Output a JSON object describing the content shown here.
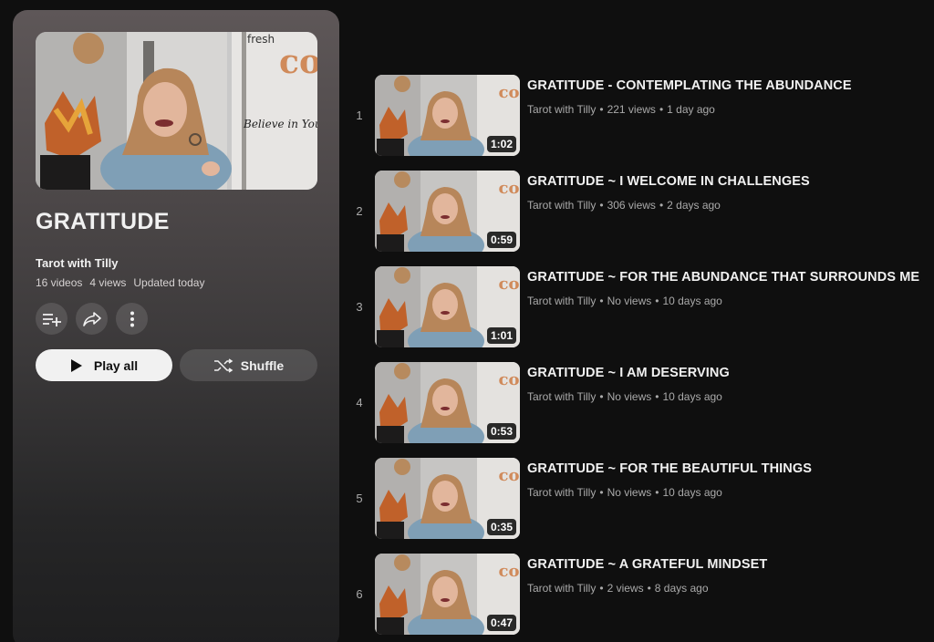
{
  "playlist": {
    "title": "GRATITUDE",
    "channel": "Tarot with Tilly",
    "video_count": "16 videos",
    "views": "4 views",
    "updated": "Updated today",
    "play_all_label": "Play all",
    "shuffle_label": "Shuffle",
    "hero_poster_text": "Believe in Yourself",
    "hero_sign_text": "fresh"
  },
  "videos": [
    {
      "index": "1",
      "title": "GRATITUDE - CONTEMPLATING THE ABUNDANCE",
      "channel": "Tarot with Tilly",
      "views": "221 views",
      "age": "1 day ago",
      "duration": "1:02"
    },
    {
      "index": "2",
      "title": "GRATITUDE ~ I WELCOME IN CHALLENGES",
      "channel": "Tarot with Tilly",
      "views": "306 views",
      "age": "2 days ago",
      "duration": "0:59"
    },
    {
      "index": "3",
      "title": "GRATITUDE ~ FOR THE ABUNDANCE THAT SURROUNDS ME",
      "channel": "Tarot with Tilly",
      "views": "No views",
      "age": "10 days ago",
      "duration": "1:01"
    },
    {
      "index": "4",
      "title": "GRATITUDE ~ I AM DESERVING",
      "channel": "Tarot with Tilly",
      "views": "No views",
      "age": "10 days ago",
      "duration": "0:53"
    },
    {
      "index": "5",
      "title": "GRATITUDE ~ FOR THE BEAUTIFUL THINGS",
      "channel": "Tarot with Tilly",
      "views": "No views",
      "age": "10 days ago",
      "duration": "0:35"
    },
    {
      "index": "6",
      "title": "GRATITUDE ~ A GRATEFUL MINDSET",
      "channel": "Tarot with Tilly",
      "views": "2 views",
      "age": "8 days ago",
      "duration": "0:47"
    }
  ],
  "colors": {
    "background": "#0f0f0f",
    "text": "#f1f1f1",
    "meta": "#aaaaaa"
  },
  "icons": [
    "add-to-queue-icon",
    "share-icon",
    "more-vert-icon",
    "play-icon",
    "shuffle-icon"
  ]
}
